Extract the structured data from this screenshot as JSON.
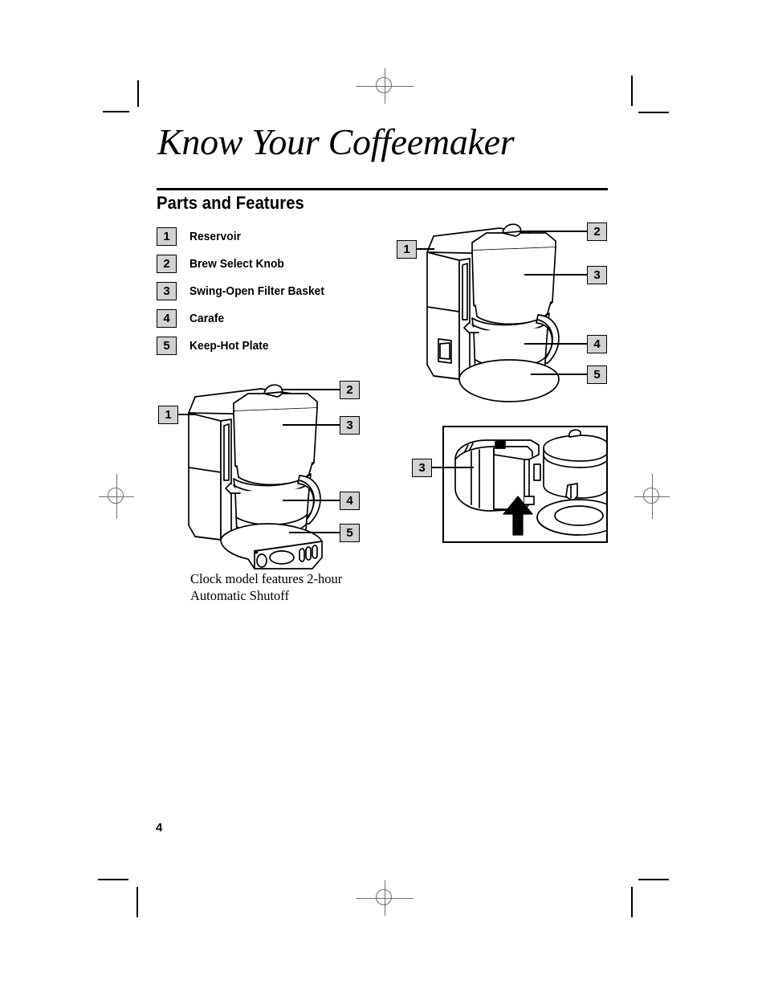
{
  "document": {
    "title": "Know Your Coffeemaker",
    "section_heading": "Parts and Features",
    "page_number": "4",
    "caption": "Clock model features 2-hour Automatic Shutoff",
    "caption_line1": "Clock model features 2-hour",
    "caption_line2": "Automatic Shutoff"
  },
  "parts_list": [
    {
      "number": "1",
      "label": "Reservoir"
    },
    {
      "number": "2",
      "label": "Brew Select Knob"
    },
    {
      "number": "3",
      "label": "Swing-Open Filter Basket"
    },
    {
      "number": "4",
      "label": "Carafe"
    },
    {
      "number": "5",
      "label": "Keep-Hot Plate"
    }
  ],
  "figures": {
    "switch_model": {
      "name": "coffeemaker-switch-model",
      "callouts": [
        {
          "number": "1"
        },
        {
          "number": "2"
        },
        {
          "number": "3"
        },
        {
          "number": "4"
        },
        {
          "number": "5"
        }
      ]
    },
    "clock_model": {
      "name": "coffeemaker-clock-model",
      "callouts": [
        {
          "number": "1"
        },
        {
          "number": "2"
        },
        {
          "number": "3"
        },
        {
          "number": "4"
        },
        {
          "number": "5"
        }
      ]
    },
    "filter_basket_detail": {
      "name": "swing-open-filter-basket-detail",
      "callouts": [
        {
          "number": "3"
        }
      ]
    }
  },
  "colors": {
    "badge_fill": "#d2d2d2",
    "line": "#000000",
    "registration": "#6e6e6e",
    "page": "#ffffff"
  }
}
